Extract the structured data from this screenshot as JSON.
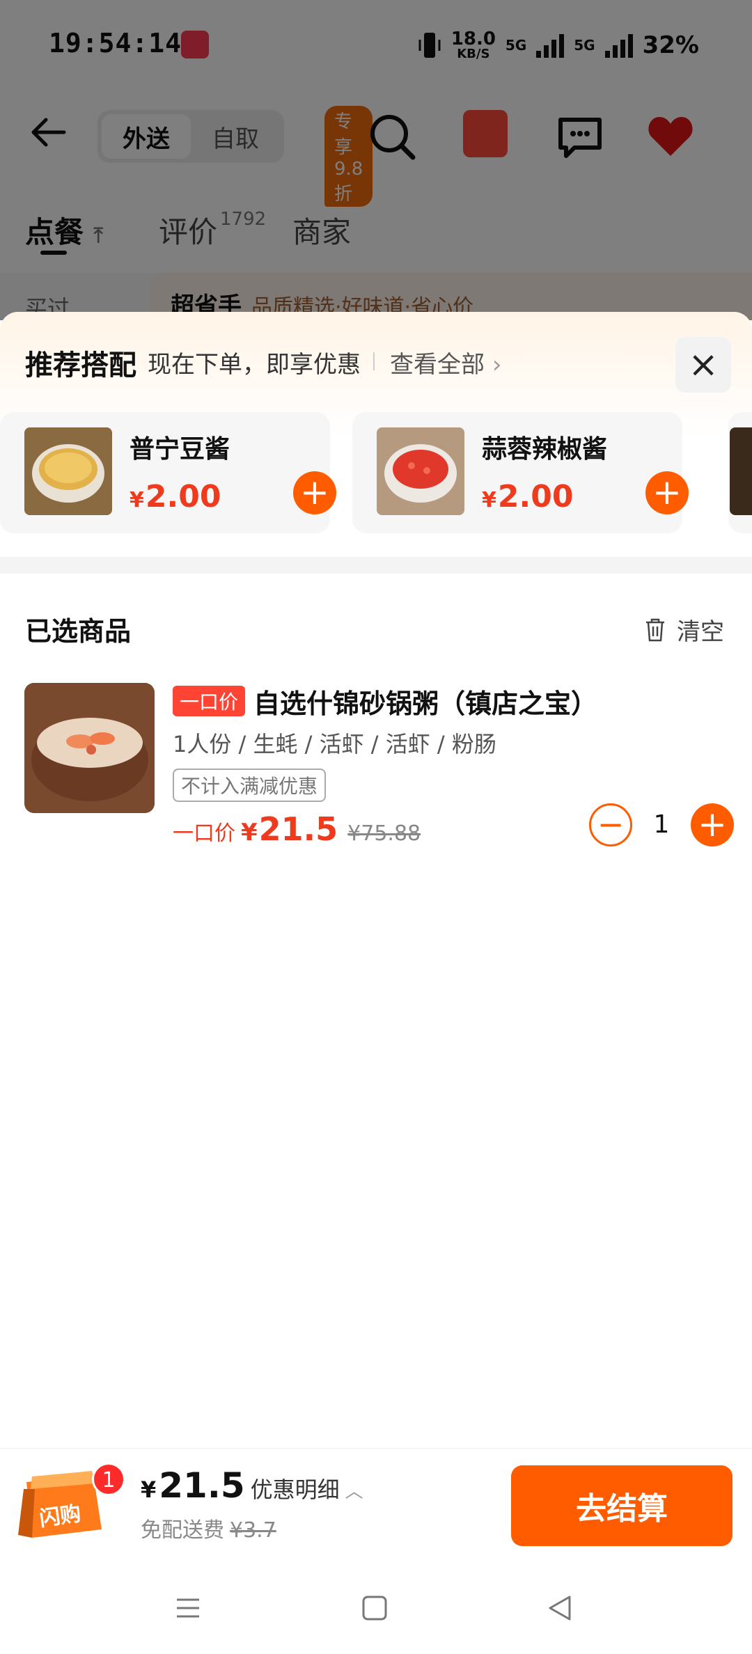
{
  "status_bar": {
    "time": "19:54:14",
    "net_speed_value": "18.0",
    "net_speed_unit": "KB/S",
    "signal1_label": "5G",
    "signal2_label": "5G",
    "battery": "32%"
  },
  "top_nav": {
    "mode_delivery": "外送",
    "mode_pickup": "自取",
    "promo_pill": "专享9.8折"
  },
  "tabs": {
    "order": "点餐",
    "reviews": "评价",
    "reviews_count": "1792",
    "merchant": "商家"
  },
  "peek": {
    "left": "买过",
    "title": "超省手",
    "subtitle": "品质精选·好味道·省心价"
  },
  "recommend": {
    "title": "推荐搭配",
    "subtitle": "现在下单，即享优惠",
    "view_all": "查看全部",
    "items": [
      {
        "name": "普宁豆酱",
        "currency": "¥",
        "price": "2.00"
      },
      {
        "name": "蒜蓉辣椒酱",
        "currency": "¥",
        "price": "2.00"
      }
    ]
  },
  "selected": {
    "title": "已选商品",
    "clear_label": "清空",
    "item": {
      "tag": "一口价",
      "name": "自选什锦砂锅粥（镇店之宝）",
      "spec": "1人份 / 生蚝 / 活虾 / 活虾 / 粉肠",
      "note": "不计入满减优惠",
      "price_label": "一口价",
      "currency": "¥",
      "price": "21.5",
      "original_price": "¥75.88",
      "quantity": "1"
    }
  },
  "checkout": {
    "cart_count": "1",
    "cart_label": "闪购",
    "currency": "¥",
    "total": "21.5",
    "discount_detail": "优惠明细",
    "delivery_free": "免配送费",
    "delivery_original": "¥3.7",
    "button": "去结算"
  },
  "colors": {
    "accent": "#ff5c00",
    "price_red": "#ee3a1d",
    "tag_red": "#ff4434"
  }
}
